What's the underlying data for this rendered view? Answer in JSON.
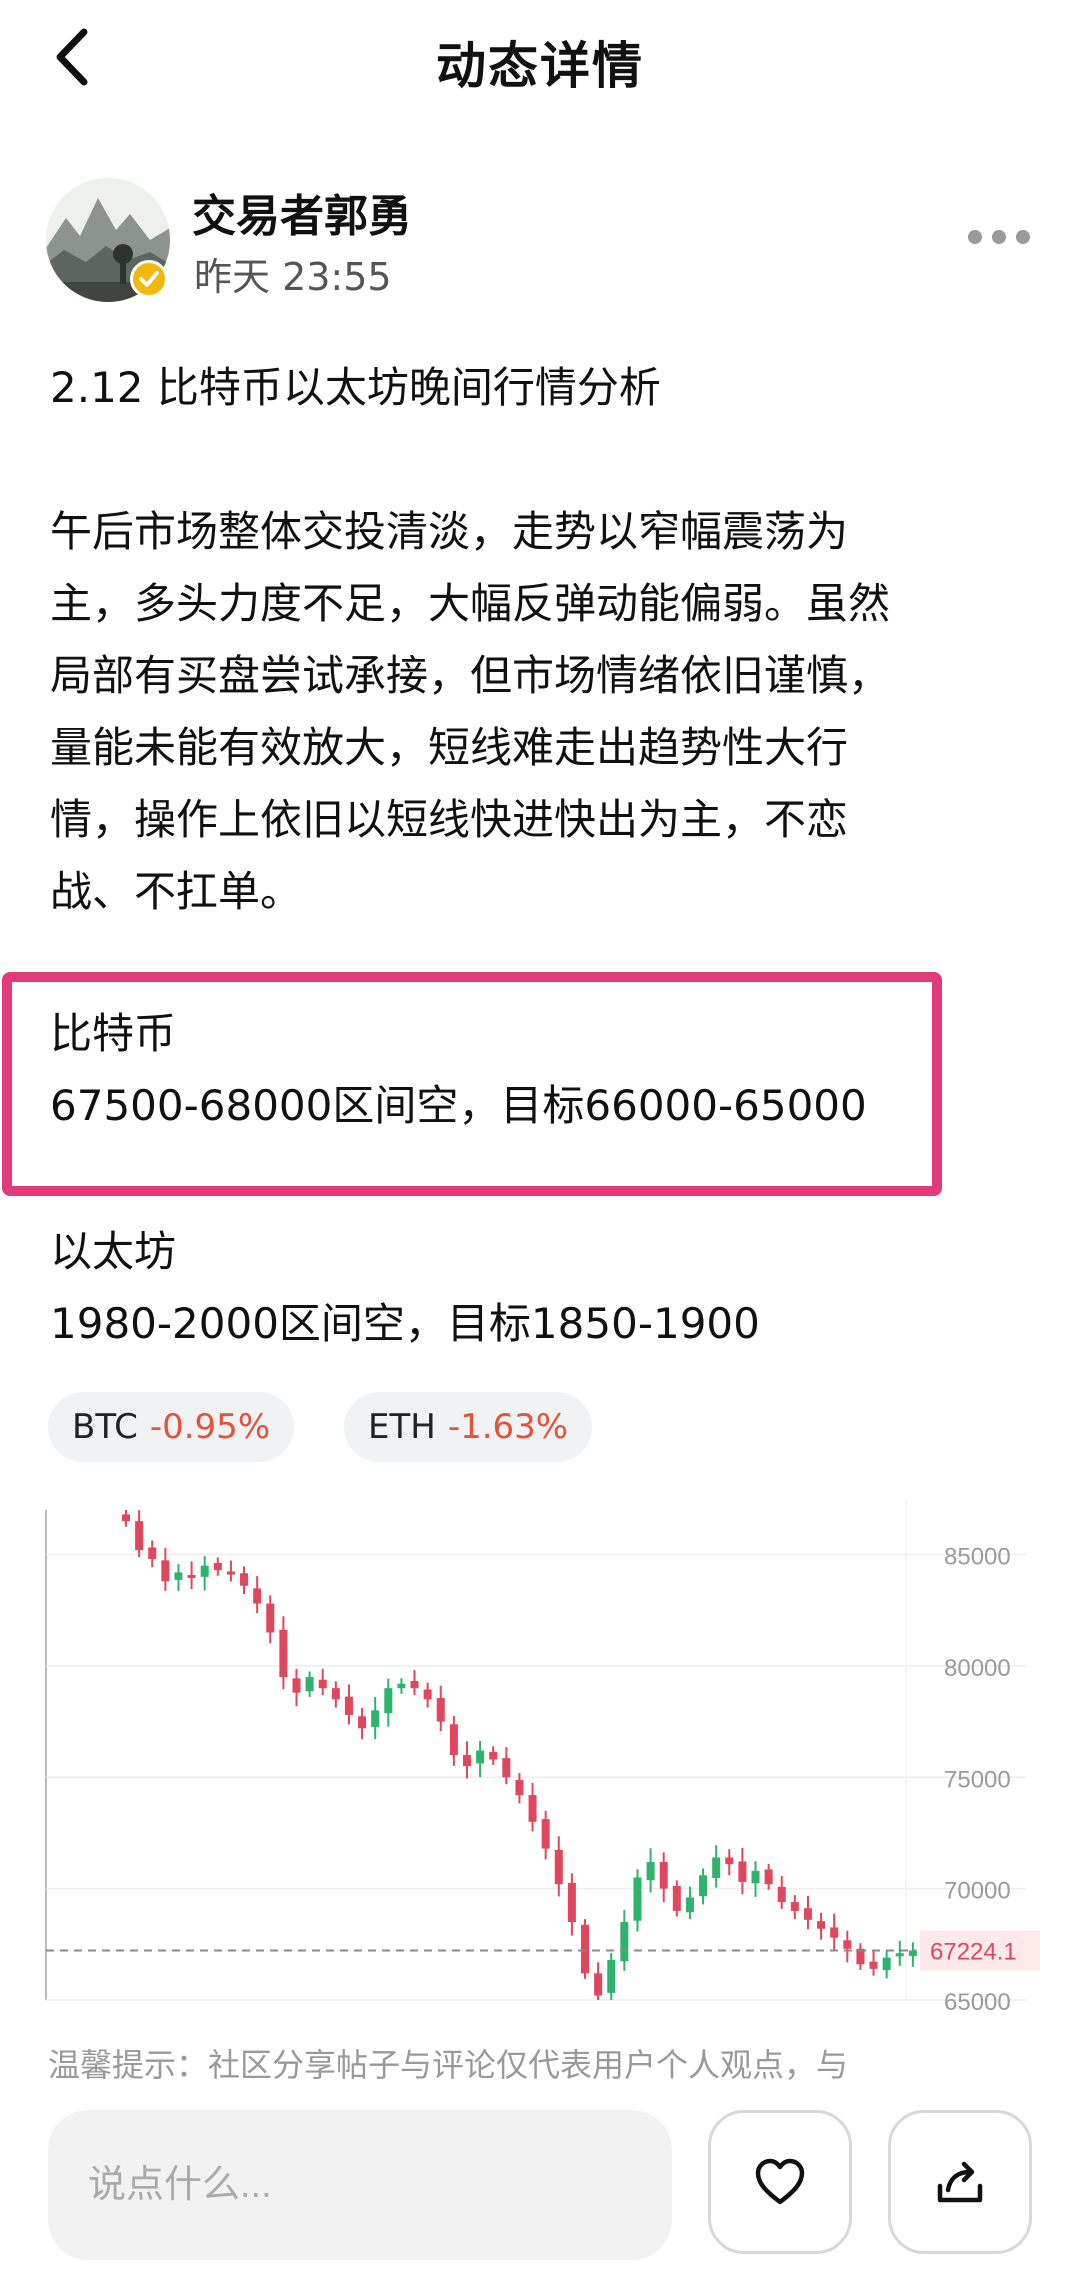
{
  "header": {
    "title": "动态详情"
  },
  "author": {
    "name": "交易者郭勇",
    "time": "昨天 23:55"
  },
  "post": {
    "title": "2.12  比特币以太坊晚间行情分析",
    "paragraph_lines": [
      "午后市场整体交投清淡，走势以窄幅震荡为",
      "主，多头力度不足，大幅反弹动能偏弱。虽然",
      "局部有买盘尝试承接，但市场情绪依旧谨慎，",
      "量能未能有效放大，短线难走出趋势性大行",
      "情，操作上依旧以短线快进快出为主，不恋",
      "战、不扛单。"
    ],
    "btc": {
      "name": "比特币",
      "plan": "67500-68000区间空，目标66000-65000"
    },
    "eth": {
      "name": "以太坊",
      "plan": "1980-2000区间空，目标1850-1900"
    }
  },
  "tags": [
    {
      "symbol": "BTC",
      "change": "-0.95%"
    },
    {
      "symbol": "ETH",
      "change": "-1.63%"
    }
  ],
  "chart_data": {
    "type": "candlestick",
    "title": "",
    "yticks": [
      85000,
      80000,
      75000,
      70000,
      65000
    ],
    "ylim": [
      65000,
      87000
    ],
    "current_price": "67224.1",
    "close_series": [
      86500,
      85200,
      84800,
      83800,
      84200,
      84000,
      84500,
      84300,
      84100,
      83600,
      82800,
      81500,
      79500,
      78800,
      79500,
      79000,
      78500,
      77800,
      77200,
      78000,
      79000,
      79200,
      79000,
      78500,
      77500,
      76000,
      75500,
      76200,
      75800,
      75000,
      74200,
      73000,
      71800,
      70200,
      68500,
      66200,
      65200,
      66800,
      68500,
      70500,
      71200,
      70000,
      69000,
      69600,
      70600,
      71400,
      71100,
      70300,
      70800,
      70200,
      69400,
      69000,
      68600,
      68200,
      67800,
      67300,
      66600,
      66400,
      66900,
      67100,
      67224
    ]
  },
  "disclaimer": "温馨提示：社区分享帖子与评论仅代表用户个人观点，与",
  "comment": {
    "placeholder": "说点什么..."
  },
  "colors": {
    "up": "#2db36b",
    "down": "#e0465c",
    "highlight": "#e23a7a",
    "negative": "#e2533a",
    "verified": "#f0b90b"
  },
  "icons": [
    "back-arrow-icon",
    "verified-badge-icon",
    "more-dots-icon",
    "heart-icon",
    "share-icon"
  ]
}
